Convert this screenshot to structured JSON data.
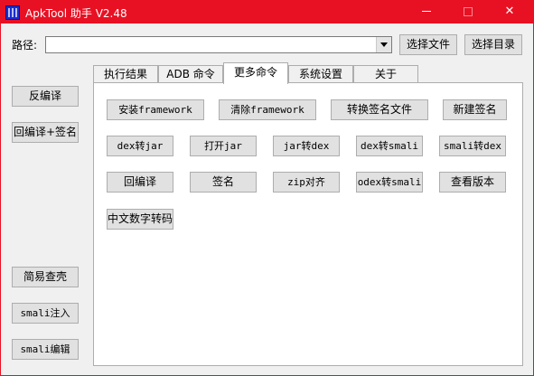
{
  "window": {
    "title": "ApkTool 助手 V2.48",
    "minimize_glyph": "",
    "close_glyph": "✕",
    "accent_color": "#e81123"
  },
  "path": {
    "label": "路径:",
    "value": "",
    "browse_file_label": "选择文件",
    "browse_dir_label": "选择目录"
  },
  "left_panel": {
    "decompile_label": "反编译",
    "recompile_sign_label": "回编译+签名",
    "shell_check_label": "简易查壳",
    "smali_inject_label": "smali注入",
    "smali_edit_label": "smali编辑"
  },
  "tabs": [
    {
      "label": "执行结果",
      "active": false
    },
    {
      "label": "ADB 命令",
      "active": false
    },
    {
      "label": "更多命令",
      "active": true
    },
    {
      "label": "系统设置",
      "active": false
    },
    {
      "label": "关于",
      "active": false
    }
  ],
  "more_commands": {
    "row1": [
      "安装framework",
      "清除framework",
      "转换签名文件",
      "新建签名"
    ],
    "row2": [
      "dex转jar",
      "打开jar",
      "jar转dex",
      "dex转smali",
      "smali转dex"
    ],
    "row3": [
      "回编译",
      "签名",
      "zip对齐",
      "odex转smali",
      "查看版本"
    ],
    "row4": [
      "中文数字转码"
    ]
  }
}
